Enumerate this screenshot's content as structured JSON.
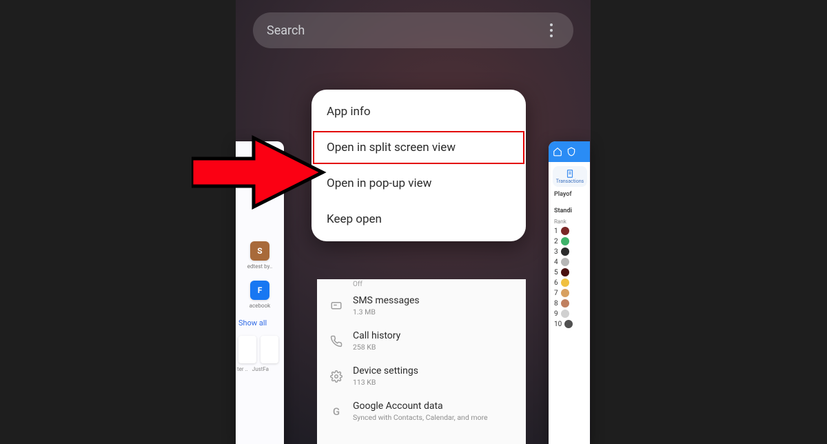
{
  "search": {
    "placeholder": "Search"
  },
  "contextMenu": {
    "items": [
      "App info",
      "Open in split screen view",
      "Open in pop-up view",
      "Keep open"
    ]
  },
  "leftCard": {
    "tile1": {
      "initial": "S",
      "label": "edtest by.."
    },
    "tile2": {
      "initial": "F",
      "label": "acebook"
    },
    "showAll": "Show all",
    "bottomTiles": [
      "ter ..",
      "JustFa"
    ]
  },
  "centerSettings": {
    "offLine": "Off",
    "rows": [
      {
        "title": "SMS messages",
        "sub": "1.3 MB"
      },
      {
        "title": "Call history",
        "sub": "258 KB"
      },
      {
        "title": "Device settings",
        "sub": "113 KB"
      },
      {
        "title": "Google Account data",
        "sub": "Synced with Contacts, Calendar, and more"
      }
    ]
  },
  "rightCard": {
    "tabLabel": "Transactions",
    "headline": "Playof",
    "standingsTitle": "Standi",
    "rankHeader": "Rank",
    "ranks": [
      "1",
      "2",
      "3",
      "4",
      "5",
      "6",
      "7",
      "8",
      "9",
      "10"
    ]
  }
}
